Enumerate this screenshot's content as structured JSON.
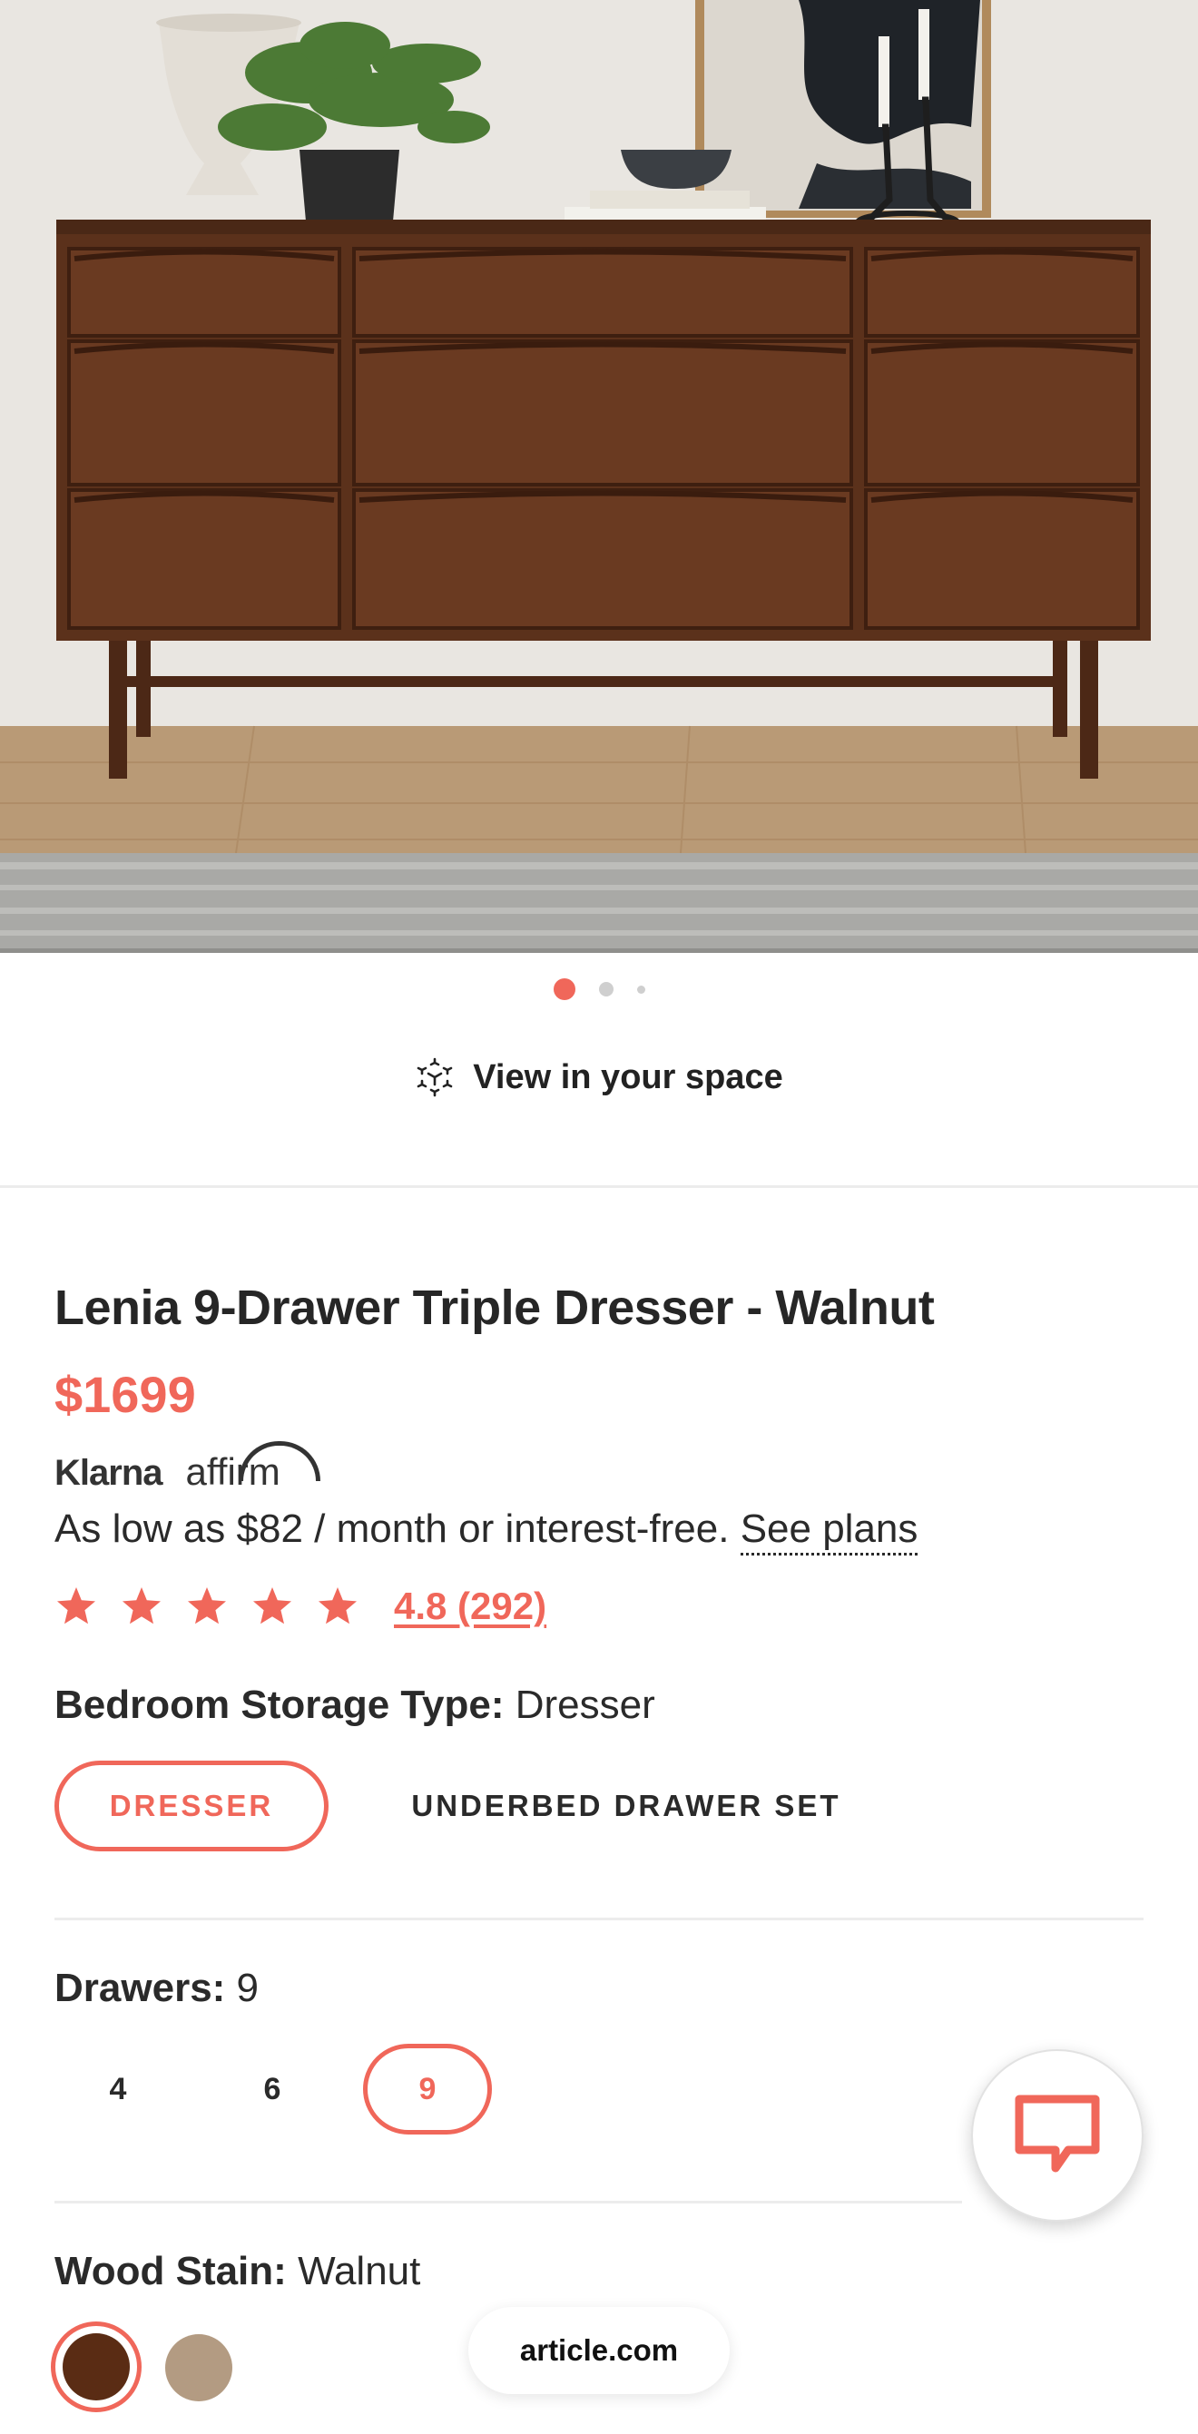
{
  "gallery": {
    "image_alt": "Walnut 9-drawer dresser in a styled room",
    "slide_count": 3,
    "active_slide": 1
  },
  "view_in_space": {
    "label": "View in your space",
    "icon": "ar-cube-icon"
  },
  "product": {
    "title": "Lenia 9-Drawer Triple Dresser - Walnut",
    "price": "$1699"
  },
  "financing": {
    "providers": [
      "Klarna",
      "affirm"
    ],
    "text": "As low as $82 / month or interest-free.",
    "link_label": "See plans"
  },
  "rating": {
    "stars": 5,
    "text": "4.8 (292)",
    "star_color": "#f0675a"
  },
  "options": {
    "storage_type": {
      "label": "Bedroom Storage Type:",
      "value": "Dresser",
      "choices": [
        {
          "label": "DRESSER",
          "selected": true
        },
        {
          "label": "UNDERBED DRAWER SET",
          "selected": false
        }
      ]
    },
    "drawers": {
      "label": "Drawers:",
      "value": "9",
      "choices": [
        {
          "label": "4",
          "selected": false
        },
        {
          "label": "6",
          "selected": false
        },
        {
          "label": "9",
          "selected": true
        }
      ]
    },
    "wood_stain": {
      "label": "Wood Stain:",
      "value": "Walnut",
      "swatches": [
        {
          "name": "Walnut",
          "color": "#5a2c14",
          "selected": true
        },
        {
          "name": "Oak",
          "color": "#b39b82",
          "selected": false
        }
      ]
    }
  },
  "chat": {
    "icon": "chat-bubble-icon"
  },
  "browser": {
    "url": "article.com"
  },
  "colors": {
    "accent": "#f0675a",
    "text": "#262626"
  }
}
